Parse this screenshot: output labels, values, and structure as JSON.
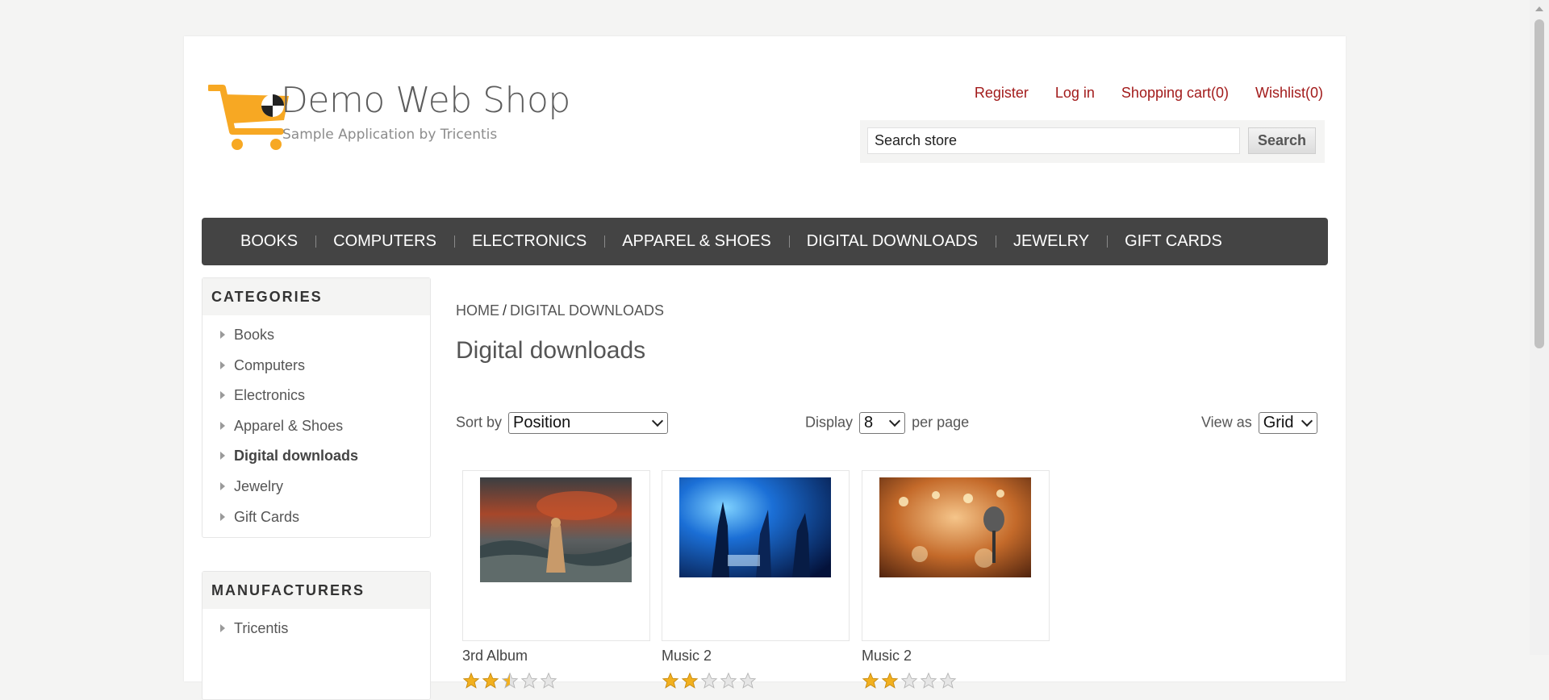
{
  "header": {
    "shop_name": "Demo Web Shop",
    "shop_subtitle": "Sample Application by Tricentis",
    "links": {
      "register": "Register",
      "login": "Log in",
      "cart": "Shopping cart(0)",
      "wishlist": "Wishlist(0)"
    },
    "search": {
      "value": "Search store",
      "button": "Search"
    }
  },
  "top_menu": [
    "BOOKS",
    "COMPUTERS",
    "ELECTRONICS",
    "APPAREL & SHOES",
    "DIGITAL DOWNLOADS",
    "JEWELRY",
    "GIFT CARDS"
  ],
  "sidebar": {
    "categories_title": "CATEGORIES",
    "categories": [
      "Books",
      "Computers",
      "Electronics",
      "Apparel & Shoes",
      "Digital downloads",
      "Jewelry",
      "Gift Cards"
    ],
    "active_category": "Digital downloads",
    "manufacturers_title": "MANUFACTURERS",
    "manufacturers": [
      "Tricentis"
    ]
  },
  "breadcrumb": {
    "home": "HOME",
    "separator": "/",
    "current": "DIGITAL DOWNLOADS"
  },
  "page_title": "Digital downloads",
  "controls": {
    "sort_label": "Sort by",
    "sort_value": "Position",
    "display_label": "Display",
    "display_value": "8",
    "per_page_label": "per page",
    "view_label": "View as",
    "view_value": "Grid"
  },
  "products": [
    {
      "name": "3rd Album",
      "rating": 2.5,
      "image": "album-cover-woman-in-sea-photo"
    },
    {
      "name": "Music 2",
      "rating": 2,
      "image": "concert-crowd-blue-photo"
    },
    {
      "name": "Music 2",
      "rating": 2,
      "image": "microphone-stage-lights-photo"
    }
  ],
  "colors": {
    "link_red": "#a21b1b",
    "menu_bg": "#444444",
    "logo_orange": "#f7a823",
    "star_gold": "#f2b01e"
  }
}
